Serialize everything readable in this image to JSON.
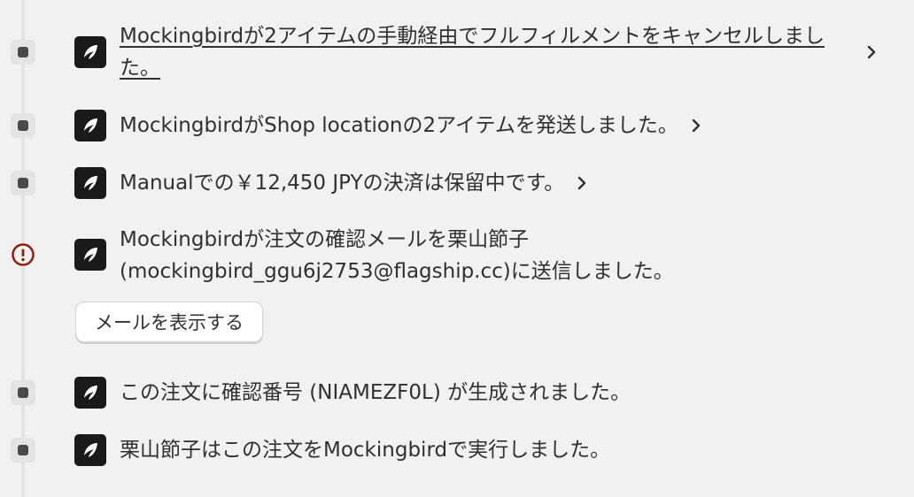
{
  "timeline": {
    "events": [
      {
        "text": "Mockingbirdが2アイテムの手動経由でフルフィルメントをキャンセルしました。"
      },
      {
        "text": "MockingbirdがShop locationの2アイテムを発送しました。"
      },
      {
        "text": "Manualでの￥12,450 JPYの決済は保留中です。"
      },
      {
        "line1": "Mockingbirdが注文の確認メールを栗山節子",
        "line2": "(mockingbird_ggu6j2753@flagship.cc)に送信しました。",
        "button": "メールを表示する"
      },
      {
        "text": "この注文に確認番号 (NIAMEZF0L) が生成されました。"
      },
      {
        "text": "栗山節子はこの注文をMockingbirdで実行しました。"
      }
    ]
  },
  "colors": {
    "background": "#f1f1f1",
    "rail": "#e3e3e3",
    "warning": "#8e1f0b",
    "avatar": "#1a1a1a"
  },
  "icons": {
    "avatar": "bird-logo-icon",
    "warning": "alert-circle-icon",
    "chevron": "chevron-right-icon"
  }
}
